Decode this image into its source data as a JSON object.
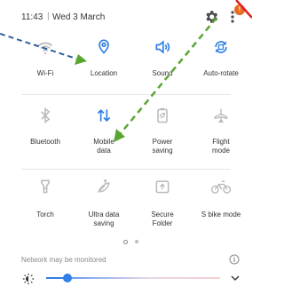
{
  "status_bar": {
    "time": "11:43",
    "separator": "|",
    "date": "Wed 3 March",
    "badge_count": "!"
  },
  "tiles": [
    {
      "label": "Wi-Fi",
      "icon": "wifi-icon",
      "state": "off"
    },
    {
      "label": "Location",
      "icon": "location-icon",
      "state": "on"
    },
    {
      "label": "Sound",
      "icon": "sound-icon",
      "state": "on"
    },
    {
      "label": "Auto-rotate",
      "icon": "auto-rotate-icon",
      "state": "on"
    },
    {
      "label": "Bluetooth",
      "icon": "bluetooth-icon",
      "state": "off"
    },
    {
      "label": "Mobile\ndata",
      "icon": "mobile-data-icon",
      "state": "on"
    },
    {
      "label": "Power\nsaving",
      "icon": "power-saving-icon",
      "state": "off"
    },
    {
      "label": "Flight\nmode",
      "icon": "flight-mode-icon",
      "state": "off"
    },
    {
      "label": "Torch",
      "icon": "torch-icon",
      "state": "off"
    },
    {
      "label": "Ultra data\nsaving",
      "icon": "ultra-data-saving-icon",
      "state": "off"
    },
    {
      "label": "Secure\nFolder",
      "icon": "secure-folder-icon",
      "state": "off"
    },
    {
      "label": "S bike mode",
      "icon": "s-bike-mode-icon",
      "state": "off"
    }
  ],
  "page_indicator": {
    "pages": 2,
    "current": 1
  },
  "footer": {
    "network_text": "Network may be monitored"
  },
  "brightness": {
    "level": 0.12
  },
  "colors": {
    "active": "#2f7fe6",
    "inactive": "#b8b8b8",
    "badge": "#e86b1f",
    "arrow_green": "#5aa632",
    "arrow_blue": "#2e5f9e",
    "annotation_red": "#e02020"
  }
}
